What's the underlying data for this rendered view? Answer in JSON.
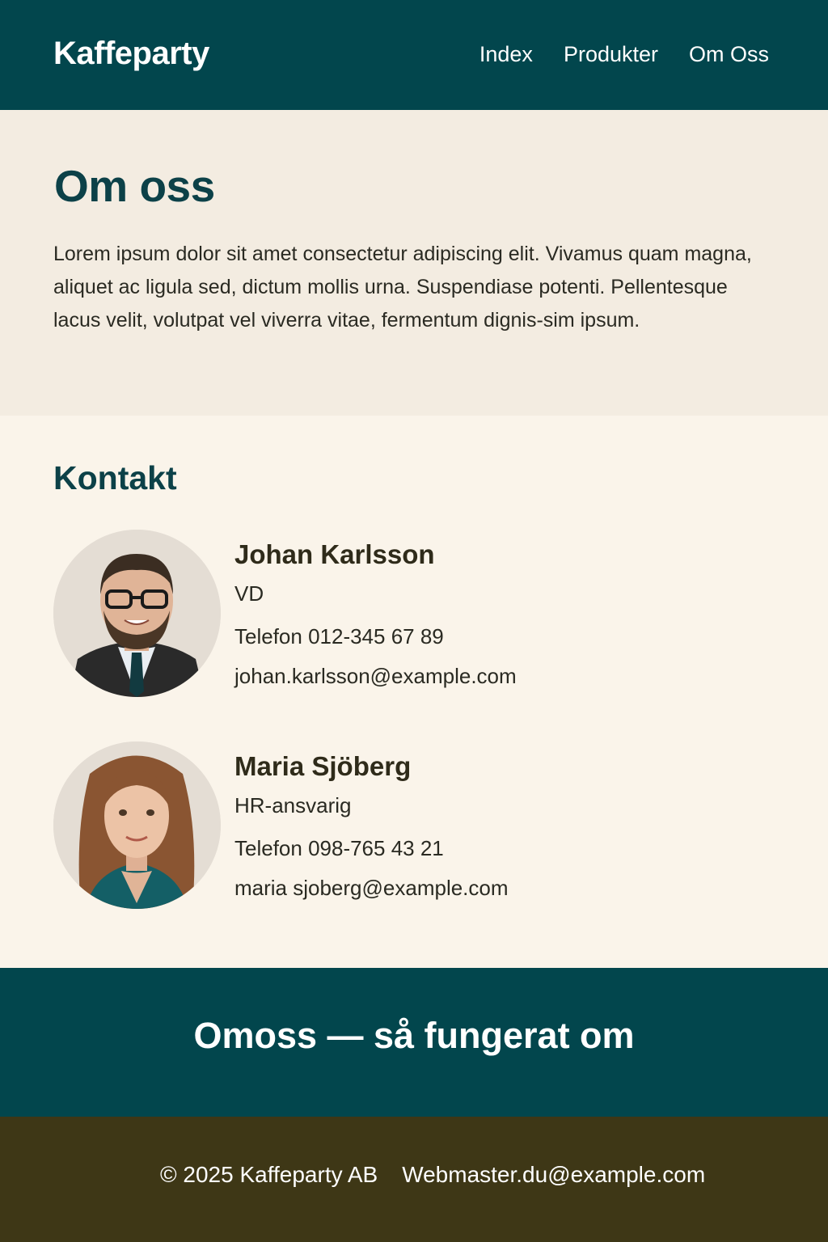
{
  "header": {
    "brand": "Kaffeparty",
    "nav": [
      "Index",
      "Produkter",
      "Om Oss"
    ]
  },
  "intro": {
    "title": "Om oss",
    "text": "Lorem ipsum dolor sit amet consectetur adipiscing elit. Vivamus quam magna, aliquet ac ligula sed, dictum mollis urna. Suspendiase potenti. Pellentesque lacus velit, volutpat vel viverra vitae, fermentum dignis-sim ipsum."
  },
  "contact": {
    "title": "Kontakt",
    "people": [
      {
        "name": "Johan Karlsson",
        "role": "VD",
        "phone": "Telefon 012-345 67 89",
        "email": "johan.karlsson@example.com"
      },
      {
        "name": "Maria Sjöberg",
        "role": "HR-ansvarig",
        "phone": "Telefon 098-765 43 21",
        "email": "maria sjoberg@example.com"
      }
    ]
  },
  "banner": {
    "text": "Omoss — så fungerat om"
  },
  "footer": {
    "copyright": "© 2025 Kaffeparty AB",
    "webmaster": "Webmaster.du@example.com"
  },
  "colors": {
    "primary": "#02464d",
    "heading": "#0c4148",
    "footer": "#3e3716",
    "background": "#faf4ea",
    "intro_background": "#f3ece1"
  }
}
